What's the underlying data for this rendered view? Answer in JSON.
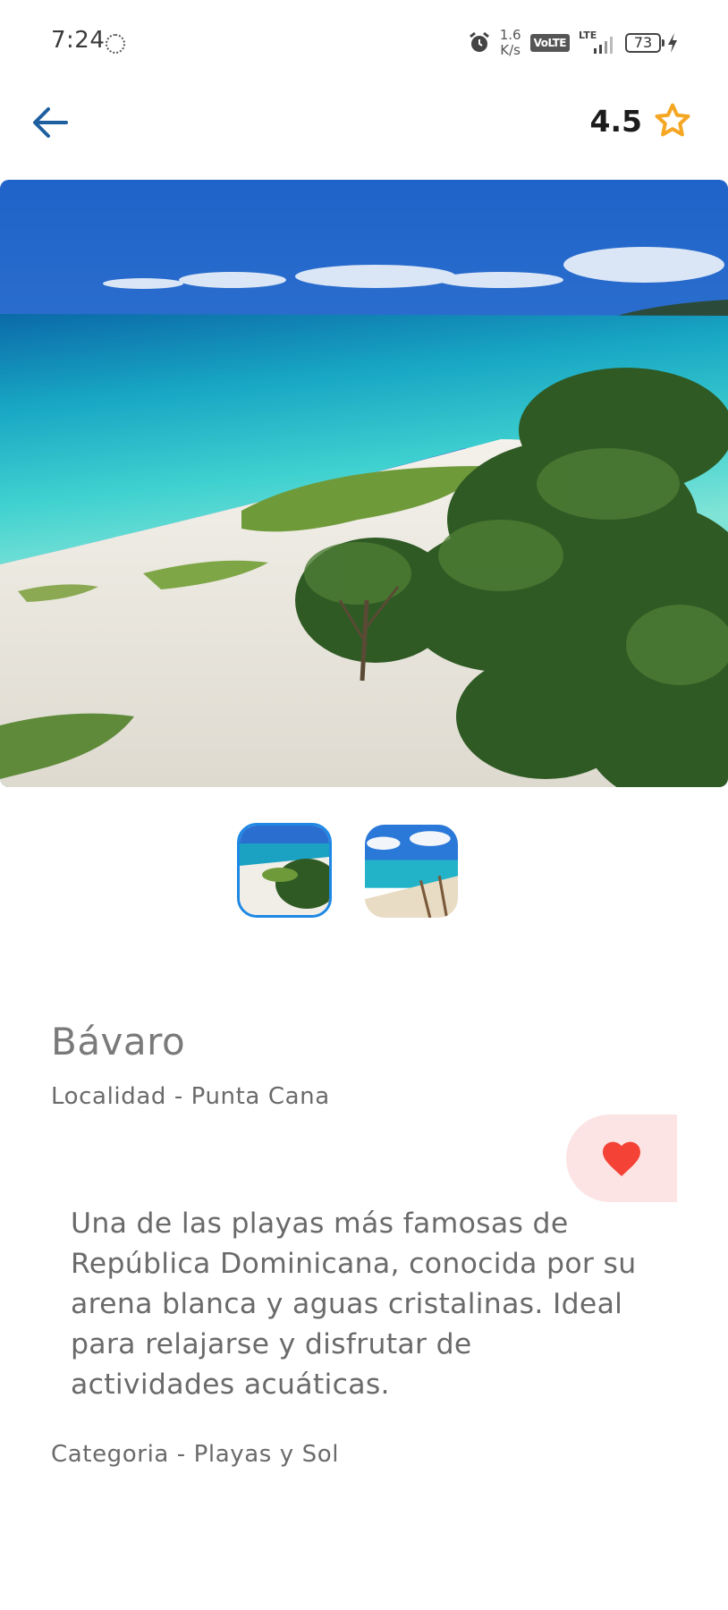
{
  "status_bar": {
    "time": "7:24",
    "net_speed_value": "1.6",
    "net_speed_unit": "K/s",
    "volte": "VoLTE",
    "lte": "LTE",
    "battery": "73"
  },
  "header": {
    "back_icon": "arrow-left-icon",
    "rating": "4.5",
    "rating_icon": "star-outline-icon"
  },
  "gallery": {
    "selected_index": 0,
    "thumbnails": [
      "beach-aerial-thumbnail",
      "beach-boardwalk-thumbnail"
    ]
  },
  "place": {
    "name": "Bávaro",
    "locality": "Localidad - Punta Cana",
    "description": "Una de las playas más famosas de República Dominicana, conocida por su arena blanca y aguas cristalinas. Ideal para relajarse y disfrutar de actividades acuáticas.",
    "category": "Categoria - Playas y Sol",
    "favorite": true
  },
  "colors": {
    "accent": "#1e5fa0",
    "star": "#f5a623",
    "heart": "#f44336",
    "favorite_bg": "#fde4e4"
  }
}
